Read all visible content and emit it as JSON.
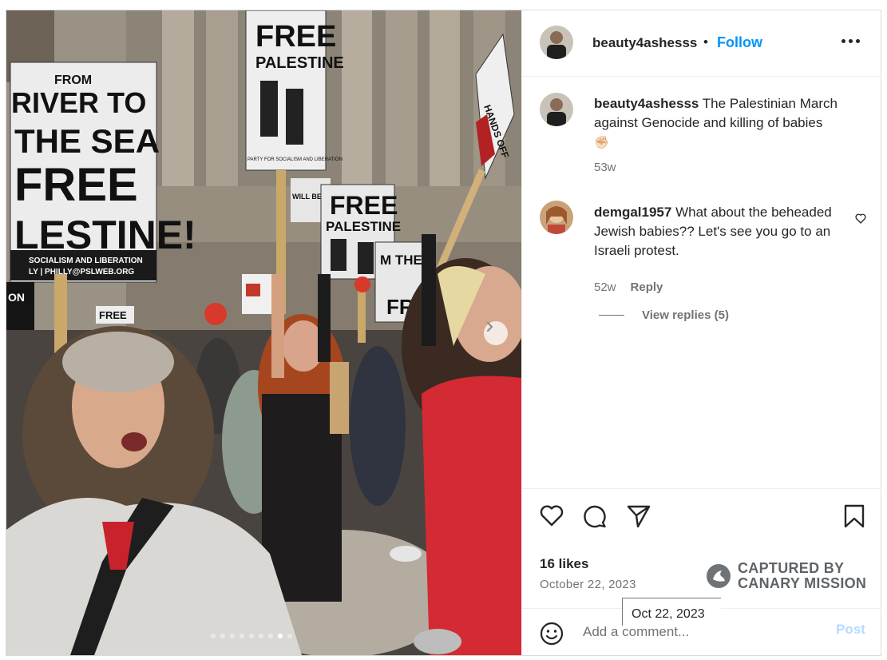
{
  "post": {
    "username": "beauty4ashesss",
    "separator": "•",
    "follow_label": "Follow",
    "more_icon": "more-horizontal-icon"
  },
  "caption": {
    "username": "beauty4ashesss",
    "text": "The Palestinian March against Genocide and killing of babies",
    "emoji": "✊🏻",
    "age": "53w"
  },
  "comments": [
    {
      "username": "demgal1957",
      "text": "What about the beheaded Jewish babies?? Let's see you go to an Israeli protest.",
      "age": "52w",
      "reply_label": "Reply",
      "view_replies": "View replies (5)"
    }
  ],
  "photo": {
    "signs": {
      "left_top": "FROM",
      "left_line1": "RIVER TO",
      "left_line2": "THE SEA",
      "left_line3": "FREE",
      "left_line4": "LESTINE!",
      "left_footer1": "SOCIALISM AND LIBERATION",
      "left_footer2": "LY | PHILLY@PSLWEB.ORG",
      "center_line1": "FREE",
      "center_line2": "PALESTINE",
      "center_footer": "PARTY FOR SOCIALISM AND LIBERATION",
      "mid_line1": "FREE",
      "mid_line2": "PALESTINE",
      "small_sign": "WILL BE FREE",
      "right_sign1": "M THE",
      "right_sign2": "FR",
      "far_right": "HANDS OFF",
      "bottom_left1": "FREE",
      "bottom_left2": "ON"
    },
    "carousel_dots": 9,
    "active_dot": 7
  },
  "stats": {
    "likes": "16 likes",
    "date": "October 22, 2023"
  },
  "watermark": {
    "line1": "CAPTURED BY",
    "line2": "CANARY MISSION"
  },
  "add_comment": {
    "placeholder": "Add a comment...",
    "post_label": "Post"
  },
  "tooltip": "Oct 22, 2023",
  "icons": [
    "heart-icon",
    "comment-icon",
    "share-icon",
    "bookmark-icon",
    "emoji-icon",
    "chevron-right-icon"
  ],
  "colors": {
    "accent": "#0095f6",
    "post_disabled": "#b3dbff",
    "muted": "#737373"
  }
}
